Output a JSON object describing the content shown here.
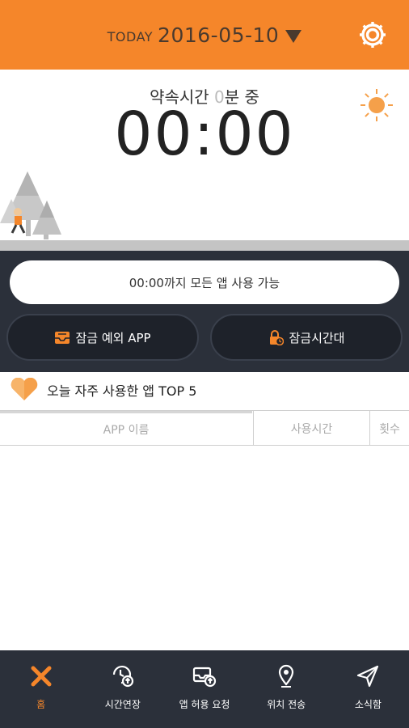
{
  "header": {
    "today_label": "TODAY",
    "date": "2016-05-10",
    "settings_icon": "gear-icon",
    "accent_color": "#f5862a"
  },
  "timer": {
    "promise_prefix": "약속시간 ",
    "promise_minutes": "0",
    "promise_suffix": "분 중",
    "display": "00:00",
    "weather_icon": "sun-icon"
  },
  "status": {
    "message": "00:00까지 모든 앱 사용 가능"
  },
  "actions": {
    "exception_app": "잠금 예외 APP",
    "lock_time": "잠금시간대"
  },
  "top5": {
    "title": "오늘 자주 사용한 앱 TOP 5",
    "columns": [
      "APP 이름",
      "사용시간",
      "횟수"
    ]
  },
  "nav": {
    "items": [
      {
        "label": "홈",
        "icon": "home-x-icon",
        "active": true
      },
      {
        "label": "시간연장",
        "icon": "time-extend-icon",
        "active": false
      },
      {
        "label": "앱 허용 요청",
        "icon": "app-request-icon",
        "active": false
      },
      {
        "label": "위치 전송",
        "icon": "location-pin-icon",
        "active": false
      },
      {
        "label": "소식함",
        "icon": "send-icon",
        "active": false
      }
    ]
  }
}
